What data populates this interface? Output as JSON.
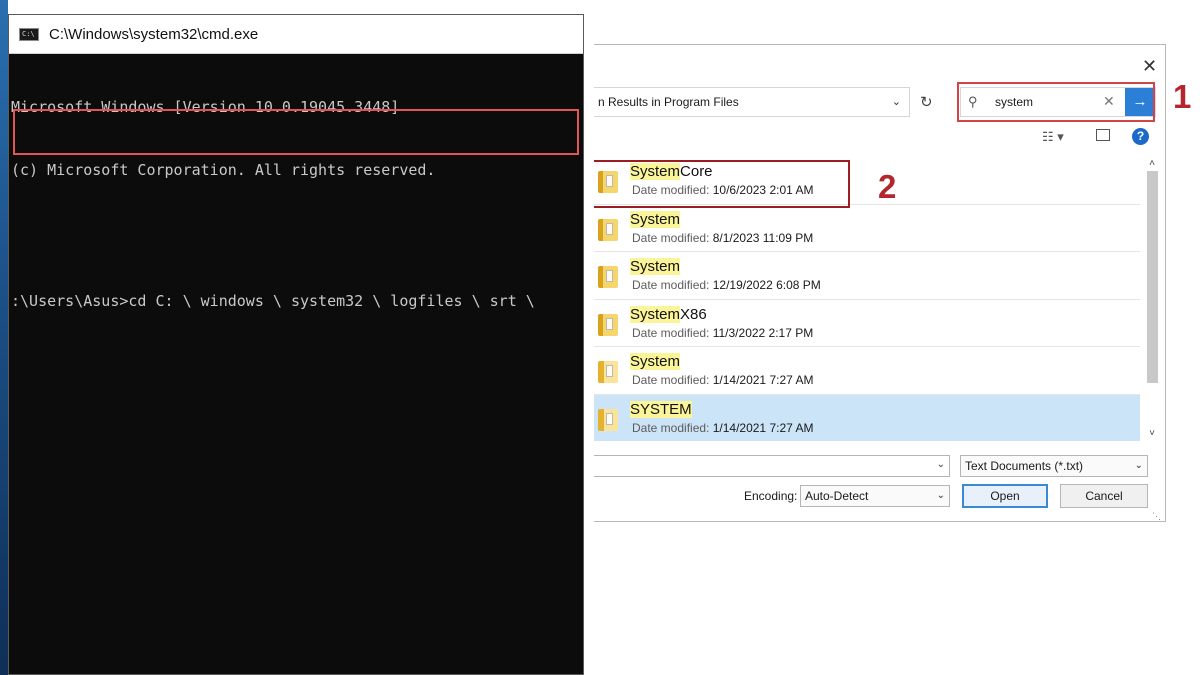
{
  "cmd": {
    "title": "C:\\Windows\\system32\\cmd.exe",
    "icon_text": "C:\\",
    "lines": [
      "Microsoft Windows [Version 10.0.19045.3448]",
      "(c) Microsoft Corporation. All rights reserved."
    ],
    "command": ":\\Users\\Asus>cd C: \\ windows \\ system32 \\ logfiles \\ srt \\"
  },
  "dialog": {
    "close_glyph": "✕",
    "address": "n Results in Program Files",
    "search": {
      "value": "system",
      "clear_glyph": "✕",
      "go_glyph": "→"
    },
    "toolbar": {
      "view_glyph": "☷ ▾",
      "help_glyph": "?"
    },
    "items": [
      {
        "highlight": "System",
        "rest": "Core",
        "date_label": "Date modified:",
        "date": "10/6/2023 2:01 AM"
      },
      {
        "highlight": "System",
        "rest": "",
        "date_label": "Date modified:",
        "date": "8/1/2023 11:09 PM"
      },
      {
        "highlight": "System",
        "rest": "",
        "date_label": "Date modified:",
        "date": "12/19/2022 6:08 PM"
      },
      {
        "highlight": "System",
        "rest": "X86",
        "date_label": "Date modified:",
        "date": "11/3/2022 2:17 PM"
      },
      {
        "highlight": "System",
        "rest": "",
        "date_label": "Date modified:",
        "date": "1/14/2021 7:27 AM"
      },
      {
        "highlight": "SYSTEM",
        "rest": "",
        "date_label": "Date modified:",
        "date": "1/14/2021 7:27 AM"
      }
    ],
    "file_type": "Text Documents (*.txt)",
    "encoding_label": "Encoding:",
    "encoding_value": "Auto-Detect",
    "open_label": "Open",
    "cancel_label": "Cancel"
  },
  "callouts": {
    "step1": "1",
    "step2": "2"
  },
  "colors": {
    "annotation_red": "#b3262d",
    "selection": "#cce4f7",
    "match_highlight": "#fbf59a"
  }
}
